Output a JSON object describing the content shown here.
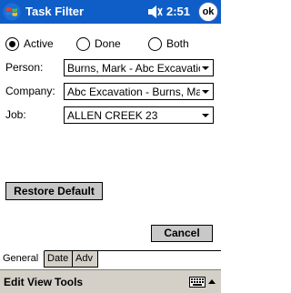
{
  "title_bar": {
    "title": "Task Filter",
    "time": "2:51",
    "ok_label": "ok",
    "start_icon": "windows-flag-icon",
    "volume_icon": "speaker-icon"
  },
  "status_filter": {
    "options": [
      {
        "label": "Active",
        "checked": true
      },
      {
        "label": "Done",
        "checked": false
      },
      {
        "label": "Both",
        "checked": false
      }
    ]
  },
  "fields": {
    "person": {
      "label": "Person:",
      "value": "Burns, Mark - Abc Excavatio"
    },
    "company": {
      "label": "Company:",
      "value": "Abc Excavation - Burns, Ma"
    },
    "job": {
      "label": "Job:",
      "value": "ALLEN CREEK 23"
    }
  },
  "buttons": {
    "restore_default": "Restore Default",
    "cancel": "Cancel"
  },
  "tabs": [
    {
      "label": "General",
      "active": true
    },
    {
      "label": "Date",
      "active": false
    },
    {
      "label": "Adv",
      "active": false
    }
  ],
  "menu": {
    "items": [
      "Edit",
      "View",
      "Tools"
    ],
    "keyboard_icon": "keyboard-icon",
    "sip_arrow_icon": "up-arrow-icon"
  },
  "colors": {
    "title_bar": "#0f5ec8",
    "button_face": "#c8c8c8",
    "menu_bar": "#d4d0c8"
  }
}
